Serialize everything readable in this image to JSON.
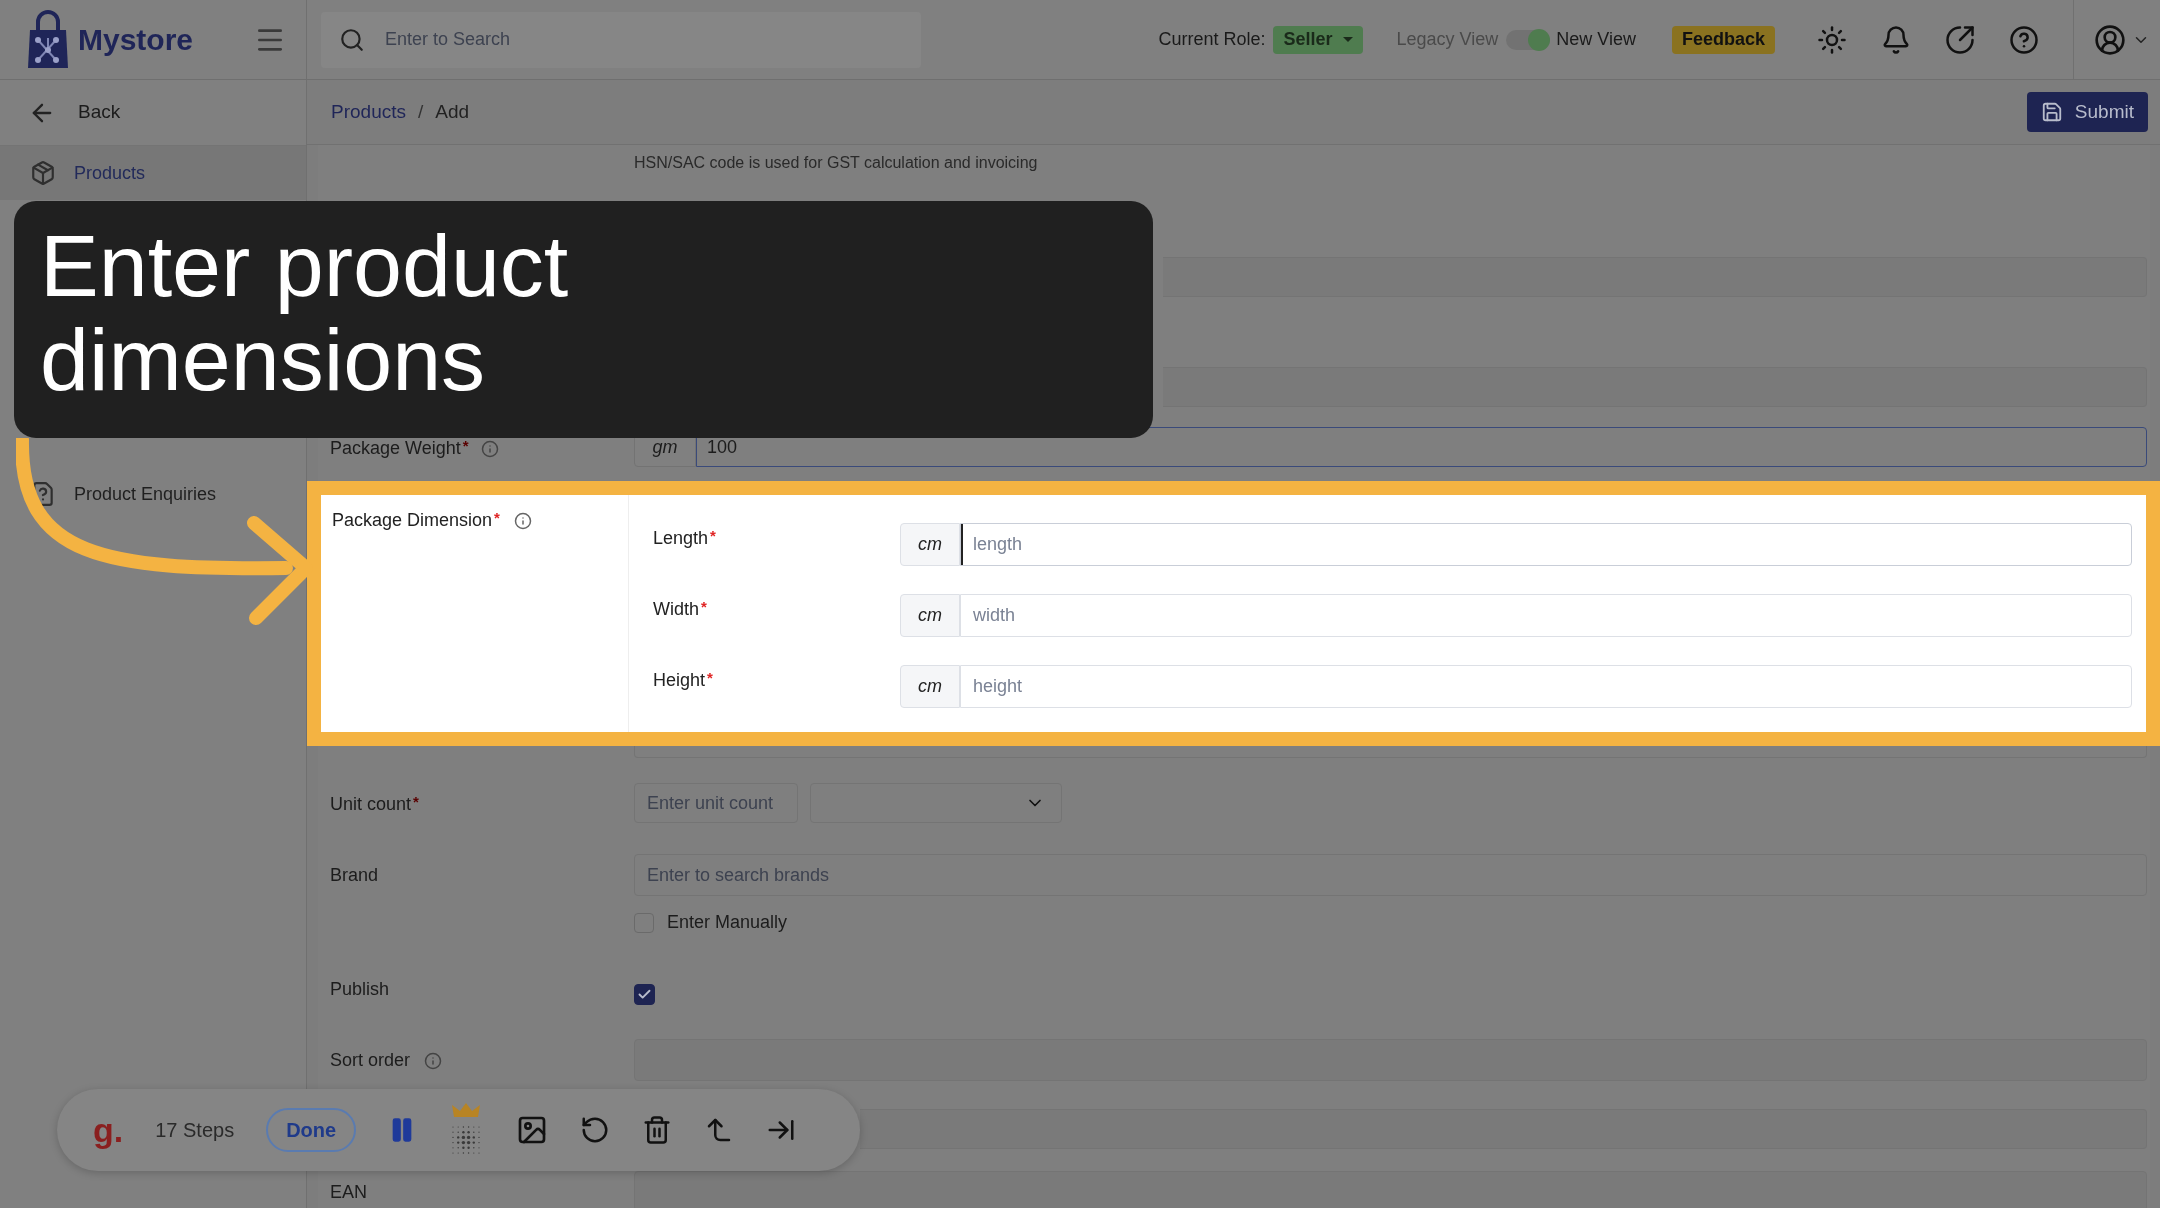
{
  "brand": {
    "name": "Mystore"
  },
  "search": {
    "placeholder": "Enter to Search"
  },
  "header": {
    "role_label": "Current Role:",
    "role": "Seller",
    "legacy_label": "Legacy View",
    "new_view_label": "New View",
    "new_view_on": true,
    "feedback": "Feedback"
  },
  "sidebar": {
    "back": "Back",
    "items": [
      {
        "label": "Products",
        "selected": true
      },
      {
        "label": "Product Enquiries",
        "selected": false
      }
    ]
  },
  "breadcrumb": {
    "items": [
      "Products",
      "Add"
    ],
    "separator": "/"
  },
  "submit": "Submit",
  "form": {
    "hsn_hint": "HSN/SAC code is used for GST calculation and invoicing",
    "package_weight": {
      "label": "Package Weight",
      "required_mark": "*",
      "unit": "gm",
      "value": "100"
    },
    "dimension": {
      "label": "Package Dimension",
      "required_mark": "*",
      "fields": [
        {
          "label": "Length",
          "required_mark": "*",
          "unit": "cm",
          "placeholder": "length",
          "focused": true
        },
        {
          "label": "Width",
          "required_mark": "*",
          "unit": "cm",
          "placeholder": "width",
          "focused": false
        },
        {
          "label": "Height",
          "required_mark": "*",
          "unit": "cm",
          "placeholder": "height",
          "focused": false
        }
      ]
    },
    "unit_count": {
      "label": "Unit count",
      "required_mark": "*",
      "placeholder": "Enter unit count"
    },
    "brand": {
      "label": "Brand",
      "placeholder": "Enter to search brands",
      "manual_label": "Enter Manually",
      "manual_checked": false
    },
    "publish": {
      "label": "Publish",
      "checked": true
    },
    "sort_order": {
      "label": "Sort order"
    },
    "ean": {
      "label": "EAN"
    }
  },
  "caption": "Enter product dimensions",
  "recorder": {
    "logo": "g.",
    "steps": "17 Steps",
    "done": "Done"
  }
}
